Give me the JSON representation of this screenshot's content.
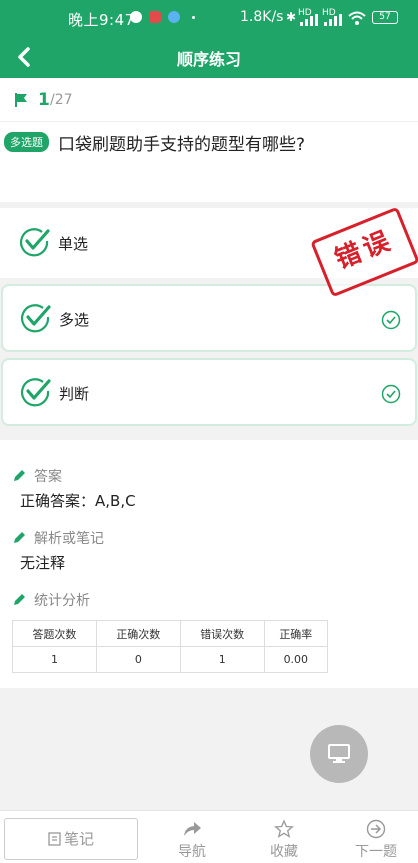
{
  "status_bar": {
    "time": "晚上9:47",
    "speed": "1.8K/s",
    "battery": "57",
    "signal_1": "HD",
    "signal_2": "HD"
  },
  "nav": {
    "title": "顺序练习",
    "back_icon": "chevron-left-icon"
  },
  "progress": {
    "current": "1",
    "total": "/27"
  },
  "question": {
    "type_badge": "多选题",
    "text": "口袋刷题助手支持的题型有哪些?"
  },
  "options": [
    {
      "label": "单选",
      "picked": false
    },
    {
      "label": "多选",
      "picked": true
    },
    {
      "label": "判断",
      "picked": true
    }
  ],
  "result_stamp": "错误",
  "analysis": {
    "answer_title": "答案",
    "answer_text": "正确答案：A,B,C",
    "notes_title": "解析或笔记",
    "notes_text": "无注释",
    "stats_title": "统计分析",
    "stats_headers": [
      "答题次数",
      "正确次数",
      "错误次数",
      "正确率"
    ],
    "stats_values": [
      "1",
      "0",
      "1",
      "0.00"
    ]
  },
  "bottom_bar": {
    "note_button": "笔记",
    "nav_tab": "导航",
    "favorite_tab": "收藏",
    "next_tab": "下一题"
  },
  "colors": {
    "primary": "#1ea567",
    "error": "#d8202a"
  }
}
